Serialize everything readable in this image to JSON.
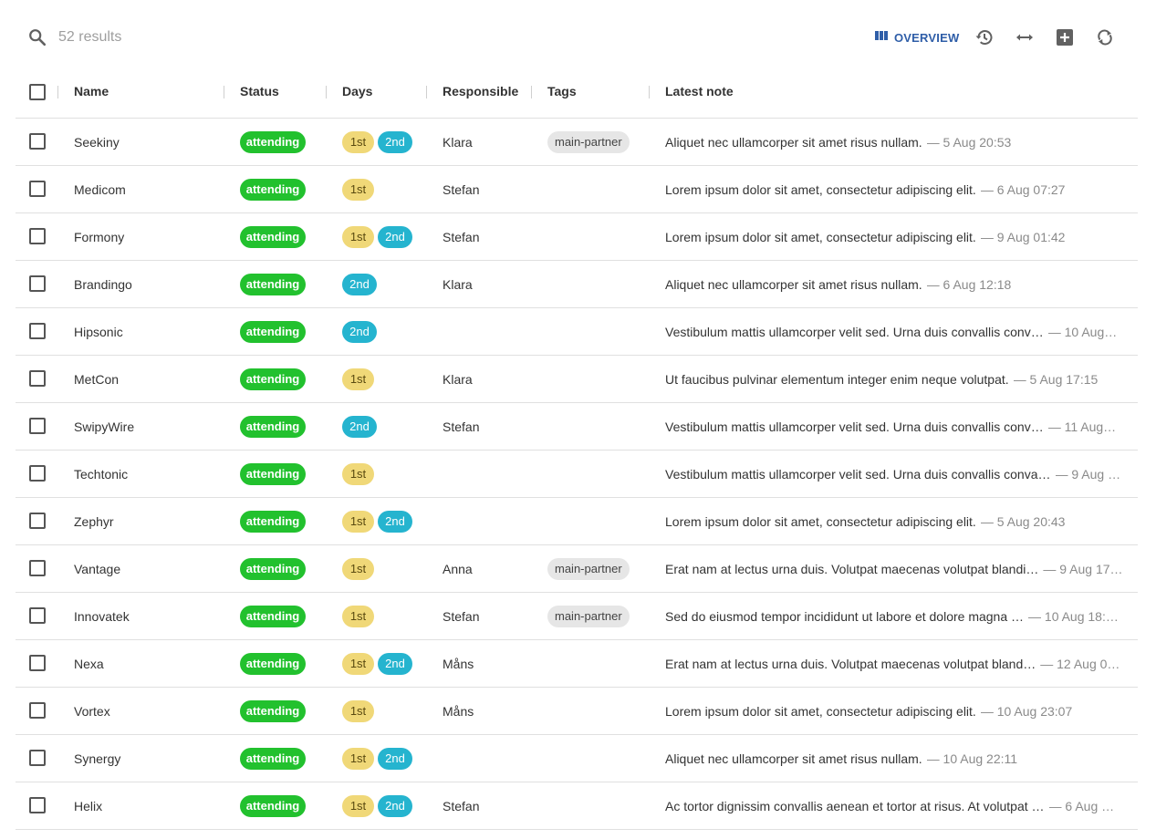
{
  "toolbar": {
    "results": "52 results",
    "overview_label": "OVERVIEW",
    "colors": {
      "accent": "#2f5ea8",
      "icon": "#616161"
    }
  },
  "columns": {
    "name": "Name",
    "status": "Status",
    "days": "Days",
    "responsible": "Responsible",
    "tags": "Tags",
    "note": "Latest note"
  },
  "colors": {
    "status_attending": "#22c12e",
    "day_1st": "#f0d878",
    "day_2nd": "#25b4cf",
    "tag": "#e6e6e6"
  },
  "rows": [
    {
      "name": "Seekiny",
      "status": "attending",
      "days": [
        "1st",
        "2nd"
      ],
      "responsible": "Klara",
      "tag": "main-partner",
      "note": "Aliquet nec ullamcorper sit amet risus nullam.",
      "time": "— 5 Aug 20:53"
    },
    {
      "name": "Medicom",
      "status": "attending",
      "days": [
        "1st"
      ],
      "responsible": "Stefan",
      "tag": "",
      "note": "Lorem ipsum dolor sit amet, consectetur adipiscing elit.",
      "time": "— 6 Aug 07:27"
    },
    {
      "name": "Formony",
      "status": "attending",
      "days": [
        "1st",
        "2nd"
      ],
      "responsible": "Stefan",
      "tag": "",
      "note": "Lorem ipsum dolor sit amet, consectetur adipiscing elit.",
      "time": "— 9 Aug 01:42"
    },
    {
      "name": "Brandingo",
      "status": "attending",
      "days": [
        "2nd"
      ],
      "responsible": "Klara",
      "tag": "",
      "note": "Aliquet nec ullamcorper sit amet risus nullam.",
      "time": "— 6 Aug 12:18"
    },
    {
      "name": "Hipsonic",
      "status": "attending",
      "days": [
        "2nd"
      ],
      "responsible": "",
      "tag": "",
      "note": "Vestibulum mattis ullamcorper velit sed. Urna duis convallis conv…",
      "time": "— 10 Aug…"
    },
    {
      "name": "MetCon",
      "status": "attending",
      "days": [
        "1st"
      ],
      "responsible": "Klara",
      "tag": "",
      "note": "Ut faucibus pulvinar elementum integer enim neque volutpat.",
      "time": "— 5 Aug 17:15"
    },
    {
      "name": "SwipyWire",
      "status": "attending",
      "days": [
        "2nd"
      ],
      "responsible": "Stefan",
      "tag": "",
      "note": "Vestibulum mattis ullamcorper velit sed. Urna duis convallis conv…",
      "time": "— 11 Aug…"
    },
    {
      "name": "Techtonic",
      "status": "attending",
      "days": [
        "1st"
      ],
      "responsible": "",
      "tag": "",
      "note": "Vestibulum mattis ullamcorper velit sed. Urna duis convallis conva…",
      "time": "— 9 Aug …"
    },
    {
      "name": "Zephyr",
      "status": "attending",
      "days": [
        "1st",
        "2nd"
      ],
      "responsible": "",
      "tag": "",
      "note": "Lorem ipsum dolor sit amet, consectetur adipiscing elit.",
      "time": "— 5 Aug 20:43"
    },
    {
      "name": "Vantage",
      "status": "attending",
      "days": [
        "1st"
      ],
      "responsible": "Anna",
      "tag": "main-partner",
      "note": "Erat nam at lectus urna duis. Volutpat maecenas volutpat blandi…",
      "time": "— 9 Aug 17…"
    },
    {
      "name": "Innovatek",
      "status": "attending",
      "days": [
        "1st"
      ],
      "responsible": "Stefan",
      "tag": "main-partner",
      "note": "Sed do eiusmod tempor incididunt ut labore et dolore magna …",
      "time": "— 10 Aug 18:…"
    },
    {
      "name": "Nexa",
      "status": "attending",
      "days": [
        "1st",
        "2nd"
      ],
      "responsible": "Måns",
      "tag": "",
      "note": "Erat nam at lectus urna duis. Volutpat maecenas volutpat bland…",
      "time": "— 12 Aug 0…"
    },
    {
      "name": "Vortex",
      "status": "attending",
      "days": [
        "1st"
      ],
      "responsible": "Måns",
      "tag": "",
      "note": "Lorem ipsum dolor sit amet, consectetur adipiscing elit.",
      "time": "— 10 Aug 23:07"
    },
    {
      "name": "Synergy",
      "status": "attending",
      "days": [
        "1st",
        "2nd"
      ],
      "responsible": "",
      "tag": "",
      "note": "Aliquet nec ullamcorper sit amet risus nullam.",
      "time": "— 10 Aug 22:11"
    },
    {
      "name": "Helix",
      "status": "attending",
      "days": [
        "1st",
        "2nd"
      ],
      "responsible": "Stefan",
      "tag": "",
      "note": "Ac tortor dignissim convallis aenean et tortor at risus. At volutpat …",
      "time": "— 6 Aug …"
    }
  ]
}
